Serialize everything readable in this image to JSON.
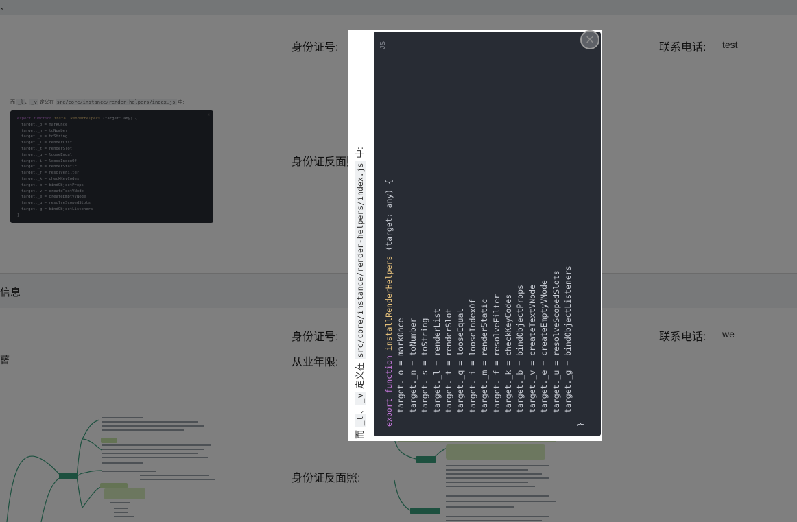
{
  "app": {
    "title": ""
  },
  "sections": {
    "top_label_fragment": "、",
    "section2_title_fragment": "信息",
    "left_fragment": "蒈"
  },
  "form1": {
    "id_label": "身份证号:",
    "phone_label": "联系电话:",
    "phone_value": "test",
    "id_back_label": "身份证反面照:"
  },
  "form2": {
    "id_label": "身份证号:",
    "phone_label": "联系电话:",
    "phone_value": "we",
    "years_label": "从业年限:",
    "id_back_label": "身份证反面照:"
  },
  "code_snippet": {
    "caption_prefix": "而",
    "caption_code1": "_l",
    "caption_sep": "、",
    "caption_code2": "_v",
    "caption_mid": "定义在",
    "caption_path": "src/core/instance/render-helpers/index.js",
    "caption_suffix": "中:",
    "copy_tag": "JS",
    "line_kw": "export function",
    "line_fn": "installRenderHelpers",
    "line_rest": "(target: any) {",
    "assignments": [
      "target._o = markOnce",
      "target._n = toNumber",
      "target._s = toString",
      "target._l = renderList",
      "target._t = renderSlot",
      "target._q = looseEqual",
      "target._i = looseIndexOf",
      "target._m = renderStatic",
      "target._f = resolveFilter",
      "target._k = checkKeyCodes",
      "target._b = bindObjectProps",
      "target._v = createTextVNode",
      "target._e = createEmptyVNode",
      "target._u = resolveScopedSlots",
      "target._g = bindObjectListeners"
    ],
    "closing": "}"
  },
  "modal": {
    "close_icon": "×"
  },
  "colors": {
    "code_bg": "#282c34",
    "keyword": "#c678dd",
    "function": "#e5c07b",
    "mind_green": "#3aa17e"
  }
}
